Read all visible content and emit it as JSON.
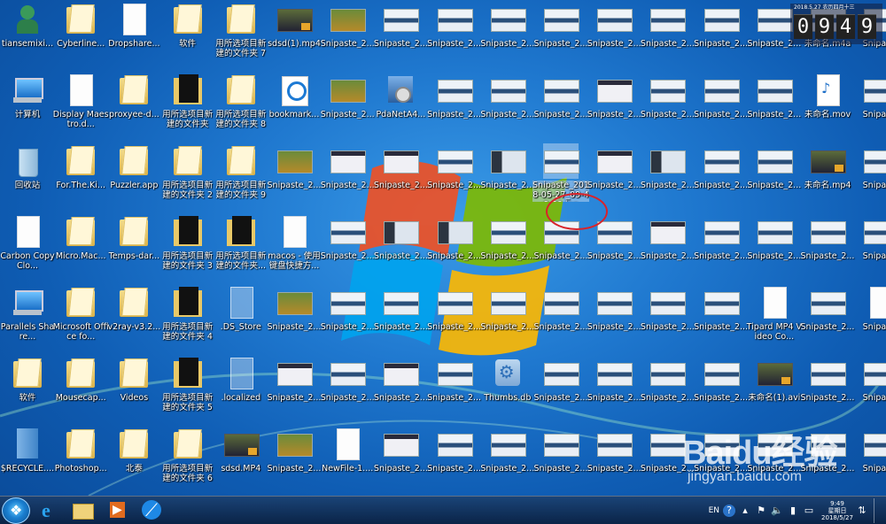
{
  "clock": {
    "header": "2018.5.27  农历四月十三",
    "digits": [
      "0",
      "9",
      "4",
      "9"
    ]
  },
  "icons": [
    {
      "label": "tiansemixi...",
      "type": "person",
      "col": 0,
      "row": 0
    },
    {
      "label": "计算机",
      "type": "computer",
      "col": 0,
      "row": 1
    },
    {
      "label": "回收站",
      "type": "trash",
      "col": 0,
      "row": 2
    },
    {
      "label": "Carbon Copy Clo...",
      "type": "file",
      "col": 0,
      "row": 3
    },
    {
      "label": "Parallels Share...",
      "type": "computer",
      "col": 0,
      "row": 4
    },
    {
      "label": "软件",
      "type": "folder",
      "col": 0,
      "row": 5
    },
    {
      "label": "$RECYCLE....",
      "type": "bin",
      "col": 0,
      "row": 6
    },
    {
      "label": "Cyberline...",
      "type": "folder",
      "col": 1,
      "row": 0
    },
    {
      "label": "Display Maestro.d...",
      "type": "file",
      "col": 1,
      "row": 1
    },
    {
      "label": "For.The.Ki...",
      "type": "folder",
      "col": 1,
      "row": 2
    },
    {
      "label": "Micro.Mac...",
      "type": "folder",
      "col": 1,
      "row": 3
    },
    {
      "label": "Microsoft Office fo...",
      "type": "folder",
      "col": 1,
      "row": 4
    },
    {
      "label": "Mousecap...",
      "type": "folder",
      "col": 1,
      "row": 5
    },
    {
      "label": "Photoshop...",
      "type": "folder",
      "col": 1,
      "row": 6
    },
    {
      "label": "Dropshare...",
      "type": "file",
      "col": 2,
      "row": 0
    },
    {
      "label": "proxyee-d...",
      "type": "folder",
      "col": 2,
      "row": 1
    },
    {
      "label": "Puzzler.app",
      "type": "folder",
      "col": 2,
      "row": 2
    },
    {
      "label": "Temps-dar...",
      "type": "folder",
      "col": 2,
      "row": 3
    },
    {
      "label": "v2ray-v3.2...",
      "type": "folder",
      "col": 2,
      "row": 4
    },
    {
      "label": "Videos",
      "type": "folder",
      "col": 2,
      "row": 5
    },
    {
      "label": "北泰",
      "type": "folder",
      "col": 2,
      "row": 6
    },
    {
      "label": "软件",
      "type": "folder",
      "col": 3,
      "row": 0
    },
    {
      "label": "用所选项目新建的文件夹",
      "type": "darkfolder",
      "col": 3,
      "row": 1
    },
    {
      "label": "用所选项目新建的文件夹 2",
      "type": "folder",
      "col": 3,
      "row": 2
    },
    {
      "label": "用所选项目新建的文件夹 3",
      "type": "darkfolder",
      "col": 3,
      "row": 3
    },
    {
      "label": "用所选项目新建的文件夹 4",
      "type": "darkfolder",
      "col": 3,
      "row": 4
    },
    {
      "label": "用所选项目新建的文件夹 5",
      "type": "darkfolder",
      "col": 3,
      "row": 5
    },
    {
      "label": "用所选项目新建的文件夹 6",
      "type": "folder",
      "col": 3,
      "row": 6
    },
    {
      "label": "用所选项目新建的文件夹 7",
      "type": "folder",
      "col": 4,
      "row": 0
    },
    {
      "label": "用所选项目新建的文件夹 8",
      "type": "folder",
      "col": 4,
      "row": 1
    },
    {
      "label": "用所选项目新建的文件夹 9",
      "type": "folder",
      "col": 4,
      "row": 2
    },
    {
      "label": "用所选项目新建的文件夹...",
      "type": "darkfolder",
      "col": 4,
      "row": 3
    },
    {
      "label": ".DS_Store",
      "type": "blank",
      "col": 4,
      "row": 4
    },
    {
      "label": ".localized",
      "type": "blank",
      "col": 4,
      "row": 5
    },
    {
      "label": "sdsd.MP4",
      "type": "video",
      "col": 4,
      "row": 6
    },
    {
      "label": "sdsd(1).mp4",
      "type": "video",
      "col": 5,
      "row": 0
    },
    {
      "label": "bookmark...",
      "type": "disc",
      "col": 5,
      "row": 1
    },
    {
      "label": "Snipaste_2...",
      "type": "shot green",
      "col": 5,
      "row": 2
    },
    {
      "label": "macos - 使用键盘快捷方...",
      "type": "file",
      "col": 5,
      "row": 3
    },
    {
      "label": "Snipaste_2...",
      "type": "shot green",
      "col": 5,
      "row": 4
    },
    {
      "label": "Snipaste_2...",
      "type": "shot dark",
      "col": 5,
      "row": 5
    },
    {
      "label": "Snipaste_2...",
      "type": "shot green",
      "col": 5,
      "row": 6
    },
    {
      "label": "Snipaste_2...",
      "type": "shot green",
      "col": 6,
      "row": 0
    },
    {
      "label": "Snipaste_2...",
      "type": "shot green",
      "col": 6,
      "row": 1
    },
    {
      "label": "Snipaste_2...",
      "type": "shot dark",
      "col": 6,
      "row": 2
    },
    {
      "label": "Snipaste_2...",
      "type": "shot",
      "col": 6,
      "row": 3
    },
    {
      "label": "Snipaste_2...",
      "type": "shot",
      "col": 6,
      "row": 4
    },
    {
      "label": "Snipaste_2...",
      "type": "shot",
      "col": 6,
      "row": 5
    },
    {
      "label": "NewFile-1....",
      "type": "file",
      "col": 6,
      "row": 6
    },
    {
      "label": "Snipaste_2...",
      "type": "shot",
      "col": 7,
      "row": 0
    },
    {
      "label": "PdaNetA4...",
      "type": "installer",
      "col": 7,
      "row": 1
    },
    {
      "label": "Snipaste_2...",
      "type": "shot dark",
      "col": 7,
      "row": 2
    },
    {
      "label": "Snipaste_2...",
      "type": "shot alt",
      "col": 7,
      "row": 3
    },
    {
      "label": "Snipaste_2...",
      "type": "shot",
      "col": 7,
      "row": 4
    },
    {
      "label": "Snipaste_2...",
      "type": "shot dark",
      "col": 7,
      "row": 5
    },
    {
      "label": "Snipaste_2...",
      "type": "shot dark",
      "col": 7,
      "row": 6
    },
    {
      "label": "Snipaste_2...",
      "type": "shot",
      "col": 8,
      "row": 0
    },
    {
      "label": "Snipaste_2...",
      "type": "shot",
      "col": 8,
      "row": 1
    },
    {
      "label": "Snipaste_2...",
      "type": "shot",
      "col": 8,
      "row": 2
    },
    {
      "label": "Snipaste_2...",
      "type": "shot alt",
      "col": 8,
      "row": 3
    },
    {
      "label": "Snipaste_2...",
      "type": "shot",
      "col": 8,
      "row": 4
    },
    {
      "label": "Snipaste_2...",
      "type": "shot",
      "col": 8,
      "row": 5
    },
    {
      "label": "Snipaste_2...",
      "type": "shot",
      "col": 8,
      "row": 6
    },
    {
      "label": "Snipaste_2...",
      "type": "shot",
      "col": 9,
      "row": 0
    },
    {
      "label": "Snipaste_2...",
      "type": "shot",
      "col": 9,
      "row": 1
    },
    {
      "label": "Snipaste_2...",
      "type": "shot alt",
      "col": 9,
      "row": 2
    },
    {
      "label": "Snipaste_2...",
      "type": "shot",
      "col": 9,
      "row": 3
    },
    {
      "label": "Snipaste_2...",
      "type": "shot",
      "col": 9,
      "row": 4
    },
    {
      "label": "Thumbs.db",
      "type": "gear",
      "col": 9,
      "row": 5
    },
    {
      "label": "Snipaste_2...",
      "type": "shot",
      "col": 9,
      "row": 6
    },
    {
      "label": "Snipaste_2...",
      "type": "shot",
      "col": 10,
      "row": 0
    },
    {
      "label": "Snipaste_2...",
      "type": "shot",
      "col": 10,
      "row": 1
    },
    {
      "label": "Snipaste_2018-05-27_09-49-30.jpg",
      "type": "shot",
      "col": 10,
      "row": 2,
      "selected": true
    },
    {
      "label": "Snipaste_2...",
      "type": "shot",
      "col": 10,
      "row": 3
    },
    {
      "label": "Snipaste_2...",
      "type": "shot",
      "col": 10,
      "row": 4
    },
    {
      "label": "Snipaste_2...",
      "type": "shot",
      "col": 10,
      "row": 5
    },
    {
      "label": "Snipaste_2...",
      "type": "shot",
      "col": 10,
      "row": 6
    },
    {
      "label": "Snipaste_2...",
      "type": "shot",
      "col": 11,
      "row": 0
    },
    {
      "label": "Snipaste_2...",
      "type": "shot dark",
      "col": 11,
      "row": 1
    },
    {
      "label": "Snipaste_2...",
      "type": "shot dark",
      "col": 11,
      "row": 2
    },
    {
      "label": "Snipaste_2...",
      "type": "shot",
      "col": 11,
      "row": 3
    },
    {
      "label": "Snipaste_2...",
      "type": "shot",
      "col": 11,
      "row": 4
    },
    {
      "label": "Snipaste_2...",
      "type": "shot",
      "col": 11,
      "row": 5
    },
    {
      "label": "Snipaste_2...",
      "type": "shot",
      "col": 11,
      "row": 6
    },
    {
      "label": "Snipaste_2...",
      "type": "shot",
      "col": 12,
      "row": 0
    },
    {
      "label": "Snipaste_2...",
      "type": "shot",
      "col": 12,
      "row": 1
    },
    {
      "label": "Snipaste_2...",
      "type": "shot alt",
      "col": 12,
      "row": 2
    },
    {
      "label": "Snipaste_2...",
      "type": "shot dark",
      "col": 12,
      "row": 3
    },
    {
      "label": "Snipaste_2...",
      "type": "shot",
      "col": 12,
      "row": 4
    },
    {
      "label": "Snipaste_2...",
      "type": "shot",
      "col": 12,
      "row": 5
    },
    {
      "label": "Snipaste_2...",
      "type": "shot",
      "col": 12,
      "row": 6
    },
    {
      "label": "Snipaste_2...",
      "type": "shot",
      "col": 13,
      "row": 0
    },
    {
      "label": "Snipaste_2...",
      "type": "shot",
      "col": 13,
      "row": 1
    },
    {
      "label": "Snipaste_2...",
      "type": "shot",
      "col": 13,
      "row": 2
    },
    {
      "label": "Snipaste_2...",
      "type": "shot",
      "col": 13,
      "row": 3
    },
    {
      "label": "Snipaste_2...",
      "type": "shot",
      "col": 13,
      "row": 4
    },
    {
      "label": "Snipaste_2...",
      "type": "shot",
      "col": 13,
      "row": 5
    },
    {
      "label": "Snipaste_2...",
      "type": "shot",
      "col": 13,
      "row": 6
    },
    {
      "label": "Snipaste_2...",
      "type": "shot",
      "col": 14,
      "row": 0
    },
    {
      "label": "Snipaste_2...",
      "type": "shot",
      "col": 14,
      "row": 1
    },
    {
      "label": "Snipaste_2...",
      "type": "shot",
      "col": 14,
      "row": 2
    },
    {
      "label": "Snipaste_2...",
      "type": "shot",
      "col": 14,
      "row": 3
    },
    {
      "label": "Tipard MP4 Video Co...",
      "type": "file",
      "col": 14,
      "row": 4
    },
    {
      "label": "未命名(1).avi",
      "type": "video",
      "col": 14,
      "row": 5
    },
    {
      "label": "Snipaste_2...",
      "type": "shot",
      "col": 14,
      "row": 6
    },
    {
      "label": "未命名.m4a",
      "type": "shot",
      "col": 15,
      "row": 0
    },
    {
      "label": "未命名.mov",
      "type": "audio",
      "col": 15,
      "row": 1
    },
    {
      "label": "未命名.mp4",
      "type": "video",
      "col": 15,
      "row": 2
    },
    {
      "label": "Snipaste_2...",
      "type": "shot",
      "col": 15,
      "row": 3
    },
    {
      "label": "Snipaste_2...",
      "type": "shot",
      "col": 15,
      "row": 4
    },
    {
      "label": "Snipaste_2...",
      "type": "shot",
      "col": 15,
      "row": 5
    },
    {
      "label": "Snipaste_2...",
      "type": "shot",
      "col": 15,
      "row": 6
    },
    {
      "label": "Snipaste",
      "type": "shot",
      "col": 16,
      "row": 0
    },
    {
      "label": "Snipaste",
      "type": "shot",
      "col": 16,
      "row": 1
    },
    {
      "label": "Snipaste",
      "type": "shot",
      "col": 16,
      "row": 2
    },
    {
      "label": "Snipaste",
      "type": "shot",
      "col": 16,
      "row": 3
    },
    {
      "label": "Snipaste",
      "type": "file",
      "col": 16,
      "row": 4
    },
    {
      "label": "Snipaste",
      "type": "shot",
      "col": 16,
      "row": 5
    },
    {
      "label": "Snipaste",
      "type": "shot",
      "col": 16,
      "row": 6
    }
  ],
  "watermark": {
    "logo": "Baidu经验",
    "url": "jingyan.baidu.com"
  },
  "taskbar": {
    "language": "EN",
    "tray_icons": [
      "help-icon",
      "flag-icon",
      "speaker-icon",
      "battery-icon",
      "display-icon",
      "network-icon"
    ],
    "clock_time": "9:49",
    "clock_day": "星期日",
    "clock_date": "2018/5/27"
  },
  "colors": {
    "annotation": "#d8232a",
    "desktop": "#1f78cf"
  }
}
